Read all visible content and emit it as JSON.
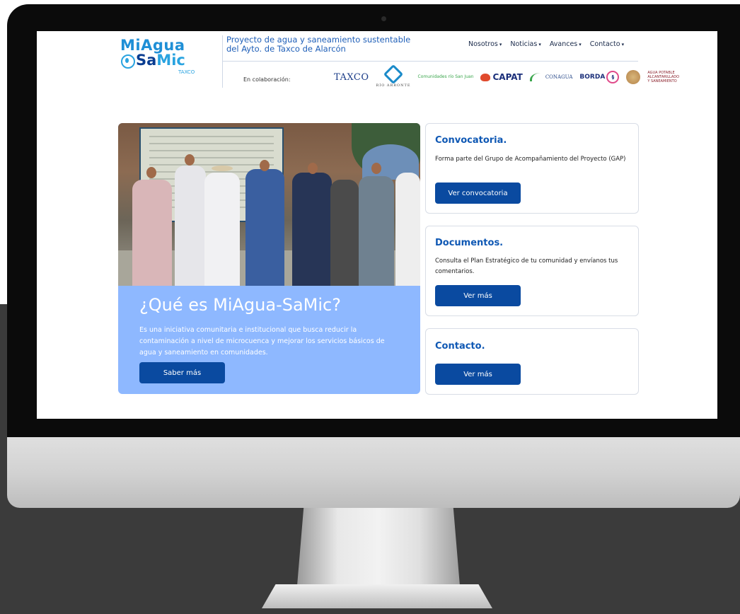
{
  "header": {
    "logo": {
      "line1": "MiAgua",
      "line2_a": "Sa",
      "line2_b": "Mic",
      "sub": "TAXCO"
    },
    "tagline": "Proyecto de agua y saneamiento sustentable del Ayto. de Taxco de Alarcón",
    "nav": [
      {
        "label": "Nosotros"
      },
      {
        "label": "Noticias"
      },
      {
        "label": "Avances"
      },
      {
        "label": "Contacto"
      }
    ],
    "collab_label": "En colaboración:",
    "partners": {
      "taxco": "TAXCO",
      "rio": "RÍO ARRONTE",
      "comunidades": "Comunidades río San Juan",
      "capat": "CAPAT",
      "conagua": "CONAGUA",
      "borda": "BORDA",
      "agua": "AGUA POTABLE ALCANTARILLADO Y SANEAMIENTO"
    }
  },
  "hero": {
    "title": "¿Qué es MiAgua-SaMic?",
    "text": "Es una iniciativa comunitaria e institucional que busca reducir la contaminación a nivel de microcuenca y mejorar los servicios básicos de agua y saneamiento en comunidades.",
    "button": "Saber más"
  },
  "cards": [
    {
      "title": "Convocatoria.",
      "text": "Forma parte del Grupo de Acompañamiento del Proyecto (GAP)",
      "button": "Ver convocatoria"
    },
    {
      "title": "Documentos.",
      "text": "Consulta el Plan Estratégico de tu comunidad y envíanos tus comentarios.",
      "button": "Ver más"
    },
    {
      "title": "Contacto.",
      "text": "",
      "button": "Ver más"
    }
  ],
  "colors": {
    "primary_button": "#0a4aa0",
    "hero_bg": "#8eb8ff",
    "title_blue": "#0f58b4"
  }
}
